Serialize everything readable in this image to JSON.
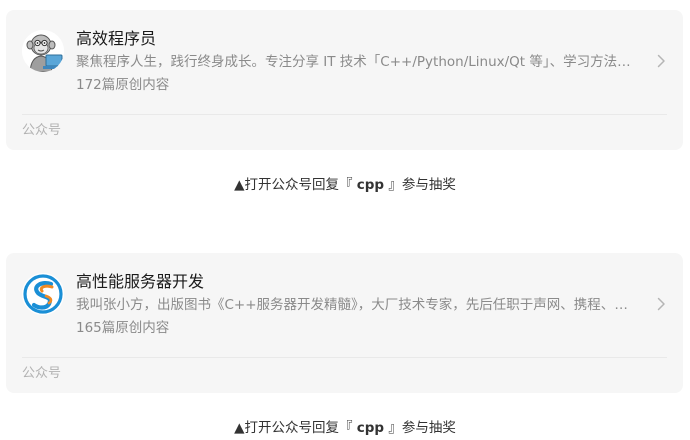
{
  "cards": [
    {
      "name": "高效程序员",
      "description": "聚焦程序人生，践行终身成长。专注分享 IT 技术「C++/Python/Linux/Qt 等」、学习方法与职场经验，欢迎关注",
      "count": "172篇原创内容",
      "footer": "公众号"
    },
    {
      "name": "高性能服务器开发",
      "description": "我叫张小方，出版图书《C++服务器开发精髓》，大厂技术专家，先后任职于声网、携程、字节跳动等公司",
      "count": "165篇原创内容",
      "footer": "公众号"
    }
  ],
  "captions": [
    {
      "prefix": "▲打开公众号回复『 ",
      "keyword": "cpp",
      "suffix": " 』参与抽奖"
    },
    {
      "prefix": "▲打开公众号回复『 ",
      "keyword": "cpp",
      "suffix": " 』参与抽奖"
    }
  ],
  "icons": {
    "avatar_1": "cartoon-monkey-programmer-avatar",
    "avatar_2": "s-swirl-logo-avatar",
    "chevron": "chevron-right-icon"
  },
  "colors": {
    "card_bg": "#f6f6f6",
    "title": "#1a1a1a",
    "meta": "#8a8a8a",
    "footer": "#b2b2b2",
    "logo_blue": "#1a8fd6",
    "logo_orange": "#f08a24"
  }
}
